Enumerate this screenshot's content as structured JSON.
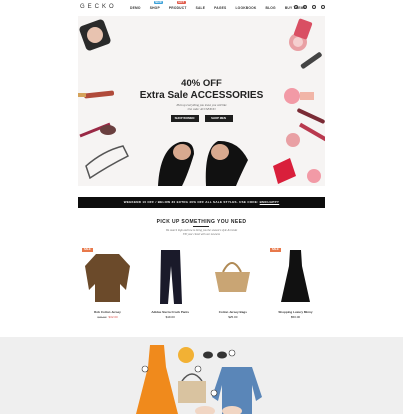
{
  "header": {
    "logo": "GECKO",
    "nav": [
      {
        "label": "DEMO",
        "badge": ""
      },
      {
        "label": "SHOP",
        "badge": "NEW"
      },
      {
        "label": "PRODUCT",
        "badge": "HOT"
      },
      {
        "label": "SALE",
        "badge": ""
      },
      {
        "label": "PAGES",
        "badge": ""
      },
      {
        "label": "LOOKBOOK",
        "badge": ""
      },
      {
        "label": "BLOG",
        "badge": ""
      },
      {
        "label": "BUY THEME",
        "badge": ""
      }
    ],
    "colors": {
      "new_badge": "#3aa0d8",
      "hot_badge": "#e05a4a"
    },
    "icons": [
      "search-icon",
      "user-icon",
      "heart-icon",
      "cart-icon"
    ]
  },
  "hero": {
    "percent": "40% OFF",
    "title": "Extra Sale ACCESSORIES",
    "subtitle_line1": "Pick up everything you leave you will like",
    "subtitle_line2": "Use code: ACCSEXOO",
    "buttons": [
      "SHOP WOMEN",
      "SHOP MEN"
    ]
  },
  "promo": {
    "text": "WEEKEND 10 OFF / BELOW 30 EXTRA 40% OFF ALL SALE STYLES. USE CODE: ",
    "code": "BMCHAPPY"
  },
  "section": {
    "title": "PICK UP SOMETHING YOU NEED",
    "sub1": "We search high and low to bring you the season's style & trends",
    "sub2": "Fill your closet with our newness"
  },
  "products": [
    {
      "name": "Rob Cotton Jersey",
      "old_price": "$39.90",
      "price": "$32.00",
      "sale": "SALE"
    },
    {
      "name": "Adidas Sierra Crock Pants",
      "old_price": "",
      "price": "$19.00",
      "sale": ""
    },
    {
      "name": "Cotton Jersey Bags",
      "old_price": "",
      "price": "$25.00",
      "sale": ""
    },
    {
      "name": "Shopping Luxury Minny",
      "old_price": "",
      "price": "$50.00",
      "sale": "SALE"
    }
  ]
}
